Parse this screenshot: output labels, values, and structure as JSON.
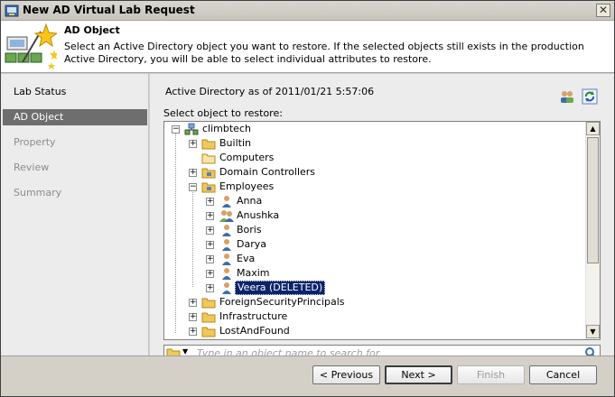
{
  "window": {
    "title": "New AD Virtual Lab Request"
  },
  "header": {
    "title": "AD Object",
    "description": "Select an Active Directory object you want to restore. If the selected objects still exists in the production Active Directory, you will be able to select individual attributes to restore."
  },
  "sidebar": {
    "items": [
      {
        "label": "Lab Status",
        "state": "done"
      },
      {
        "label": "AD Object",
        "state": "active"
      },
      {
        "label": "Property",
        "state": "pending"
      },
      {
        "label": "Review",
        "state": "pending"
      },
      {
        "label": "Summary",
        "state": "pending"
      }
    ]
  },
  "main": {
    "as_of": "Active Directory as of 2011/01/21 5:57:06",
    "select_label": "Select object to restore:",
    "search_placeholder": "Type in an object name to search for"
  },
  "tree": {
    "root": "climbtech",
    "nodes": [
      "Builtin",
      "Computers",
      "Domain Controllers",
      "Employees",
      "Anna",
      "Anushka",
      "Boris",
      "Darya",
      "Eva",
      "Maxim",
      "Veera (DELETED)",
      "ForeignSecurityPrincipals",
      "Infrastructure",
      "LostAndFound"
    ],
    "selected": "Veera (DELETED)"
  },
  "buttons": {
    "previous": "< Previous",
    "next": "Next >",
    "finish": "Finish",
    "cancel": "Cancel"
  },
  "colors": {
    "selection": "#0a246a",
    "active_nav": "#6e6e6e",
    "folder": "#f0c85a"
  }
}
